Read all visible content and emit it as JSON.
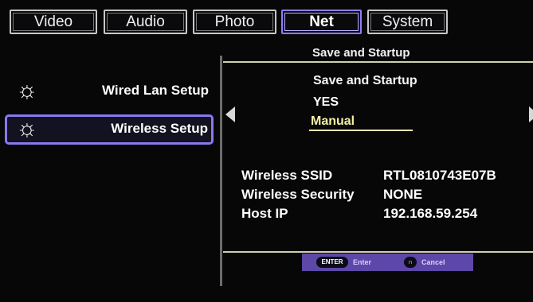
{
  "tabs": [
    {
      "label": "Video",
      "active": false
    },
    {
      "label": "Audio",
      "active": false
    },
    {
      "label": "Photo",
      "active": false
    },
    {
      "label": "Net",
      "active": true
    },
    {
      "label": "System",
      "active": false
    }
  ],
  "breadcrumb": "Save and Startup",
  "sidebar": {
    "items": [
      {
        "label": "Wired Lan Setup",
        "icon": "sun-icon",
        "selected": false
      },
      {
        "label": "Wireless Setup",
        "icon": "sun-icon",
        "selected": true
      }
    ]
  },
  "option": {
    "title": "Save and Startup",
    "choices": [
      "YES",
      "Manual"
    ],
    "selected": "Manual"
  },
  "info": {
    "ssid_label": "Wireless SSID",
    "ssid_value": "RTL0810743E07B",
    "security_label": "Wireless Security",
    "security_value": "NONE",
    "ip_label": "Host IP",
    "ip_value": "192.168.59.254"
  },
  "hints": {
    "enter_key": "ENTER",
    "enter_label": "Enter",
    "back_key": "∩",
    "back_label": "Cancel"
  },
  "colors": {
    "accent": "#8a78f2",
    "highlight_text": "#f3efa2",
    "hint_bar": "#5d47a8"
  }
}
